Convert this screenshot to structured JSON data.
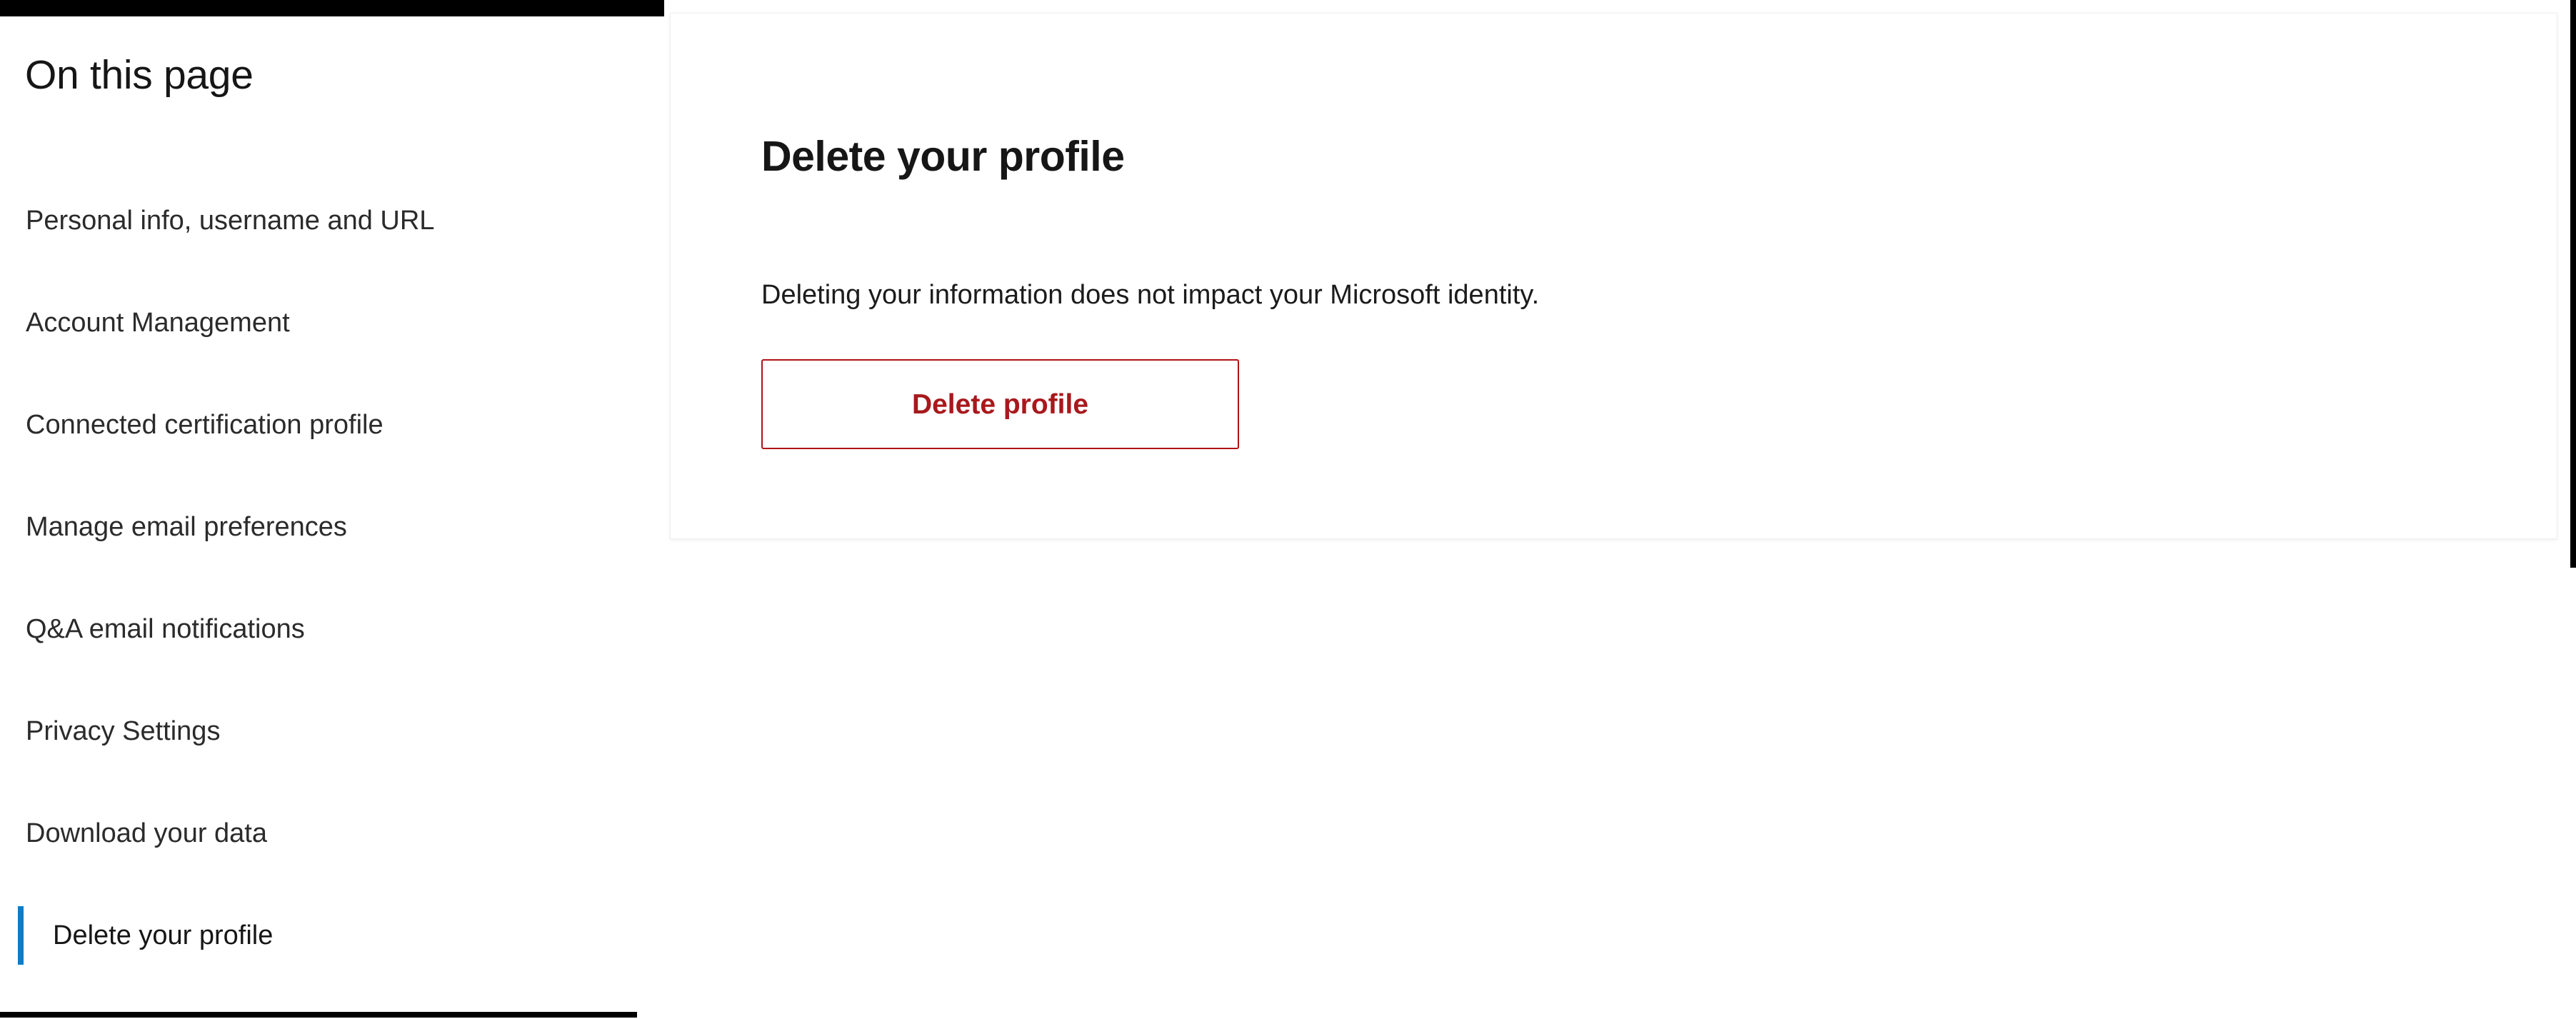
{
  "colors": {
    "chrome_bar": "#000000",
    "active_indicator": "#0f7cc4",
    "danger_border": "#b01116",
    "danger_text": "#a8181c",
    "heading_text": "#161616",
    "body_text": "#1b1b1b",
    "card_border": "#f1f1f1",
    "page_background": "#ffffff"
  },
  "sidebar": {
    "title": "On this page",
    "items": [
      {
        "label": "Personal info, username and URL",
        "active": false
      },
      {
        "label": "Account Management",
        "active": false
      },
      {
        "label": "Connected certification profile",
        "active": false
      },
      {
        "label": "Manage email preferences",
        "active": false
      },
      {
        "label": "Q&A email notifications",
        "active": false
      },
      {
        "label": "Privacy Settings",
        "active": false
      },
      {
        "label": "Download your data",
        "active": false
      },
      {
        "label": "Delete your profile",
        "active": true
      }
    ]
  },
  "main": {
    "heading": "Delete your profile",
    "description": "Deleting your information does not impact your Microsoft identity.",
    "delete_button_label": "Delete profile"
  }
}
